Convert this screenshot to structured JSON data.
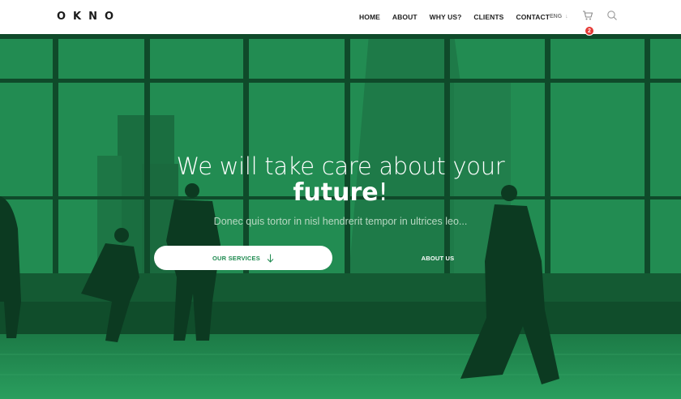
{
  "brand": {
    "logo": "OKNO"
  },
  "nav": {
    "items": [
      {
        "label": "HOME"
      },
      {
        "label": "ABOUT"
      },
      {
        "label": "WHY US?"
      },
      {
        "label": "CLIENTS"
      },
      {
        "label": "CONTACT"
      }
    ],
    "language": "ENG",
    "cart_count": "2"
  },
  "hero": {
    "headline_line1": "We will take care about your",
    "headline_bold": "future",
    "headline_end": "!",
    "subtitle": "Donec quis tortor in nisl hendrerit tempor in ultrices leo...",
    "primary_button": "OUR SERVICES",
    "secondary_button": "ABOUT US"
  },
  "colors": {
    "accent_green": "#1f8a50",
    "badge_red": "#e53935"
  },
  "icons": [
    "cart-icon",
    "search-icon",
    "chevron-down-icon",
    "arrow-down-icon"
  ]
}
